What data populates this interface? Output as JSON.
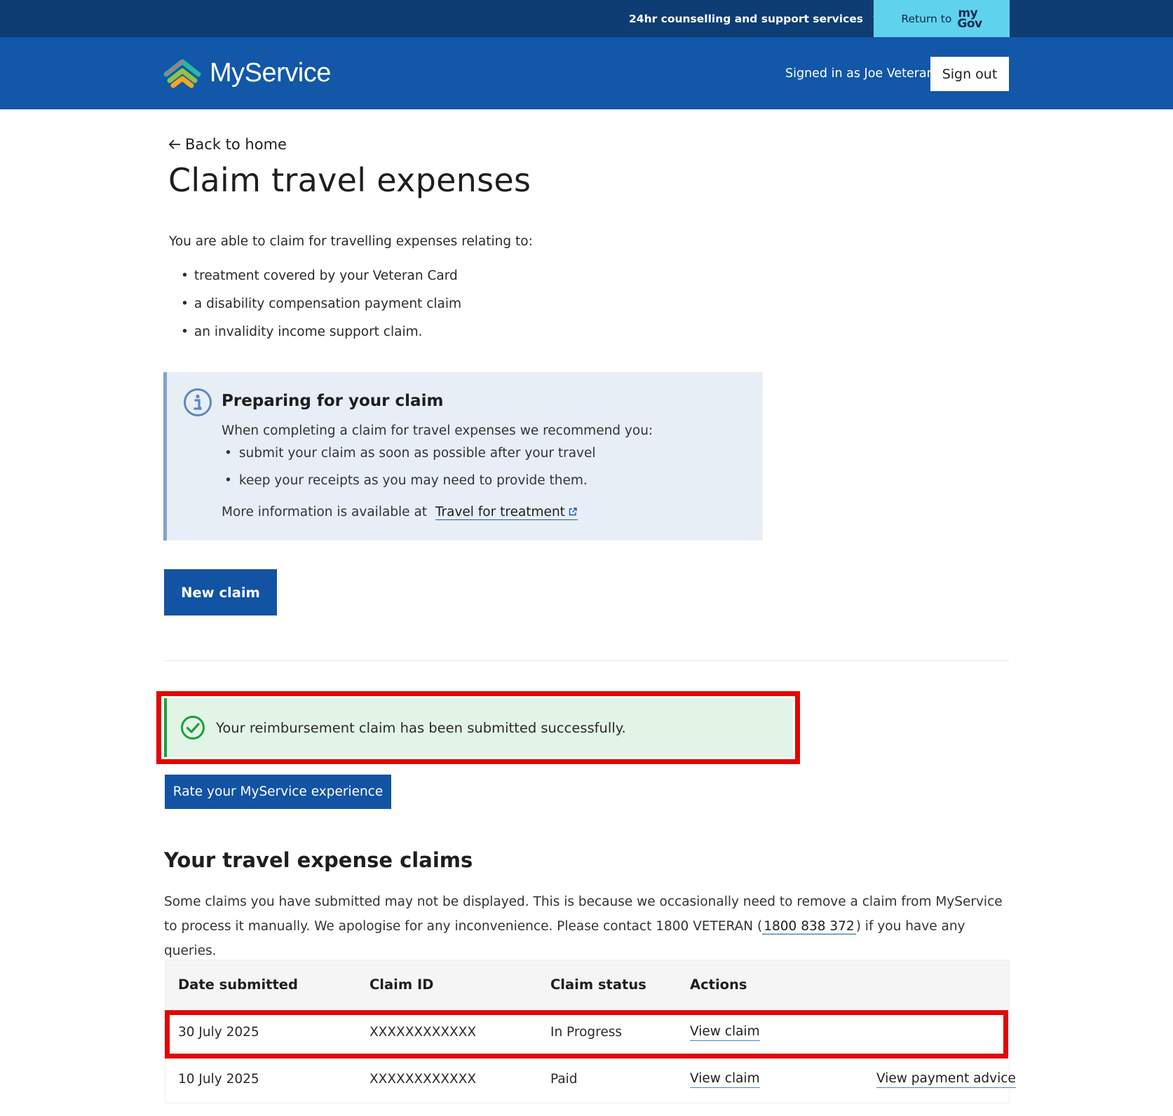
{
  "topbar": {
    "counselling_label": "24hr counselling and support services",
    "return_label": "Return to",
    "mygov_line1": "my",
    "mygov_line2": "Gov",
    "background": "#0e3d73",
    "mygov_color": "#5fd2ee"
  },
  "header": {
    "brand_name": "MyService",
    "signed_in_text": "Signed in as Joe Veteran",
    "sign_out_label": "Sign out",
    "background": "#1257a8"
  },
  "page": {
    "back_link": "Back to home",
    "title": "Claim travel expenses",
    "intro": "You are able to claim for travelling expenses relating to:",
    "intro_items": [
      "treatment covered by your Veteran Card",
      "a disability compensation payment claim",
      "an invalidity income support claim."
    ]
  },
  "info": {
    "icon": "info-icon",
    "title": "Preparing for your claim",
    "text": "When completing a claim for travel expenses we recommend you:",
    "items": [
      "submit your claim as soon as possible after your travel",
      "keep your receipts as you may need to provide them."
    ],
    "more_prefix": "More information is available at",
    "more_link": "Travel for treatment"
  },
  "actions": {
    "new_claim_label": "New claim",
    "rate_label": "Rate your MyService experience",
    "button_color": "#1253a3"
  },
  "success": {
    "icon": "check-circle-icon",
    "message": "Your reimbursement claim has been submitted successfully.",
    "background": "#e2f4e6",
    "accent": "#1a9f3d"
  },
  "claims": {
    "title": "Your travel expense claims",
    "note_part1": "Some claims you have submitted may not be displayed. This is because we occasionally need to remove a claim from MyService to process it manually. We apologise for any inconvenience. Please contact 1800 VETERAN (",
    "note_phone": "1800 838 372",
    "note_part2": ") if you have any queries.",
    "headers": [
      "Date submitted",
      "Claim ID",
      "Claim status",
      "Actions"
    ],
    "rows": [
      {
        "date": "30 July 2025",
        "claim_id": "XXXXXXXXXXXX",
        "status": "In Progress",
        "view_label": "View claim",
        "payment_label": ""
      },
      {
        "date": "10 July 2025",
        "claim_id": "XXXXXXXXXXXX",
        "status": "Paid",
        "view_label": "View claim",
        "payment_label": "View payment advice"
      }
    ]
  },
  "highlight_color": "#e10600"
}
